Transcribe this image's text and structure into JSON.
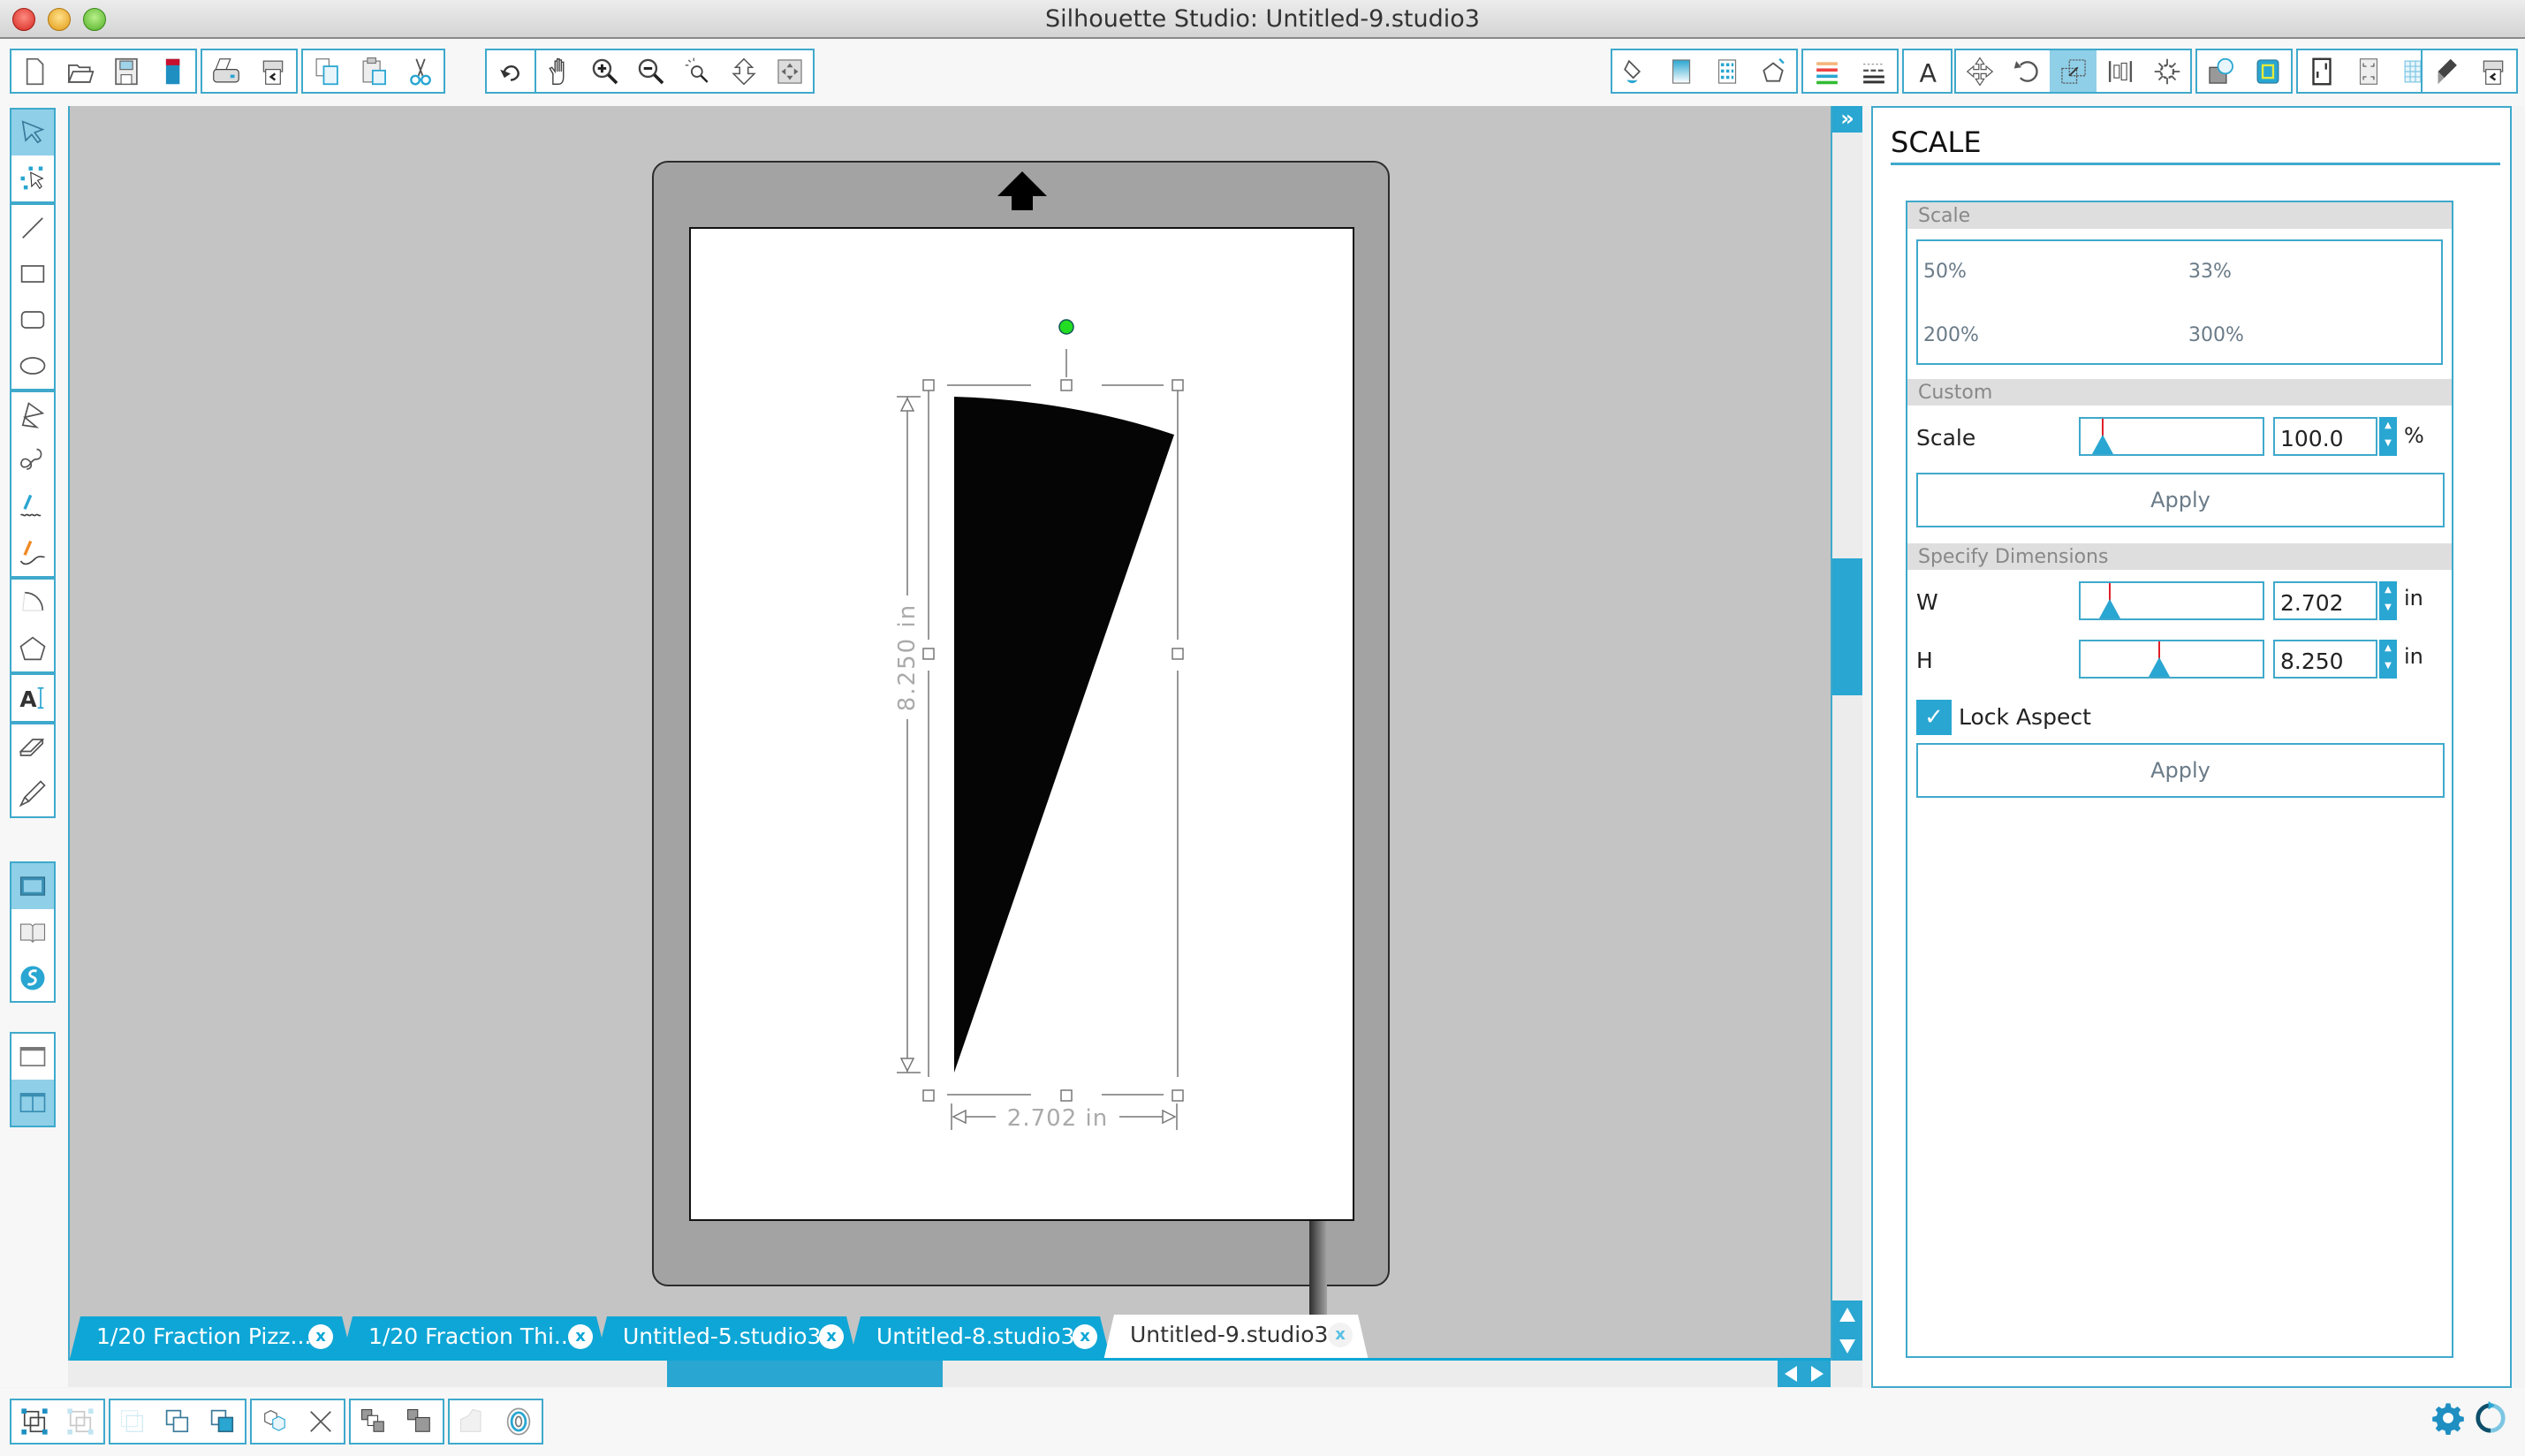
{
  "window": {
    "title": "Silhouette Studio: Untitled-9.studio3"
  },
  "toolbar_top": {
    "groups": [
      [
        "new-document",
        "open-file",
        "save-file",
        "save-to-library"
      ],
      [
        "print",
        "send-to-cutter"
      ],
      [
        "copy",
        "paste",
        "cut"
      ],
      [
        "undo",
        "redo"
      ],
      [
        "pan",
        "zoom-in",
        "zoom-out",
        "zoom-select",
        "drag-zoom",
        "fit-to-page"
      ],
      [
        "fill-color",
        "fill-gradient",
        "fill-pattern",
        "line-style"
      ],
      [
        "line-color",
        "line-style-dashes"
      ],
      [
        "text-style"
      ],
      [
        "transform",
        "rotate",
        "scale",
        "align",
        "replicate"
      ],
      [
        "modify",
        "offset"
      ],
      [
        "page-setup",
        "registration-marks",
        "grid"
      ],
      [
        "cut-settings",
        "send"
      ]
    ],
    "active": "scale"
  },
  "toolbar_left": {
    "groups": [
      [
        "select",
        "point-edit"
      ],
      [
        "line",
        "rectangle",
        "rounded-rectangle",
        "ellipse"
      ],
      [
        "polygon",
        "curve",
        "freehand",
        "smooth-freehand"
      ],
      [
        "arc",
        "regular-polygon"
      ],
      [
        "text"
      ],
      [
        "eraser",
        "knife"
      ],
      [
        "design-view",
        "library",
        "silhouette-store"
      ],
      [
        "single-panel",
        "split-panel"
      ]
    ],
    "active": [
      "select",
      "design-view",
      "split-panel"
    ]
  },
  "canvas": {
    "shape": "pizza-slice",
    "width_label": "2.702 in",
    "height_label": "8.250 in"
  },
  "tabs": [
    {
      "label": "1/20 Fraction Pizz...",
      "active": false
    },
    {
      "label": "1/20 Fraction Thi...",
      "active": false
    },
    {
      "label": "Untitled-5.studio3",
      "active": false
    },
    {
      "label": "Untitled-8.studio3",
      "active": false
    },
    {
      "label": "Untitled-9.studio3",
      "active": true
    }
  ],
  "tab_close_glyph": "x",
  "panel": {
    "title": "SCALE",
    "scale_section": {
      "heading": "Scale",
      "presets": [
        "50%",
        "33%",
        "200%",
        "300%"
      ]
    },
    "custom_section": {
      "heading": "Custom",
      "label": "Scale",
      "value": "100.0",
      "unit": "%",
      "slider_fraction": 0.12,
      "apply": "Apply"
    },
    "dimensions_section": {
      "heading": "Specify Dimensions",
      "width_label": "W",
      "width_value": "2.702",
      "width_unit": "in",
      "width_slider_fraction": 0.16,
      "height_label": "H",
      "height_value": "8.250",
      "height_unit": "in",
      "height_slider_fraction": 0.43,
      "lock_aspect_label": "Lock Aspect",
      "lock_aspect_checked": true,
      "apply": "Apply"
    }
  },
  "toolbar_bottom": {
    "groups": [
      [
        "group",
        "ungroup"
      ],
      [
        "make-compound-path",
        "release-compound-path",
        "bring-to-front"
      ],
      [
        "weld",
        "delete"
      ],
      [
        "send-forward",
        "send-backward"
      ],
      [
        "trace",
        "offset-circle"
      ]
    ],
    "corner": [
      "settings",
      "sync"
    ]
  },
  "colors": {
    "accent": "#29a6d1",
    "tab": "#0ea6d6",
    "mat": "#a3a3a3",
    "canvas_bg": "#c4c4c4",
    "rotate_handle": "#22dd22"
  }
}
